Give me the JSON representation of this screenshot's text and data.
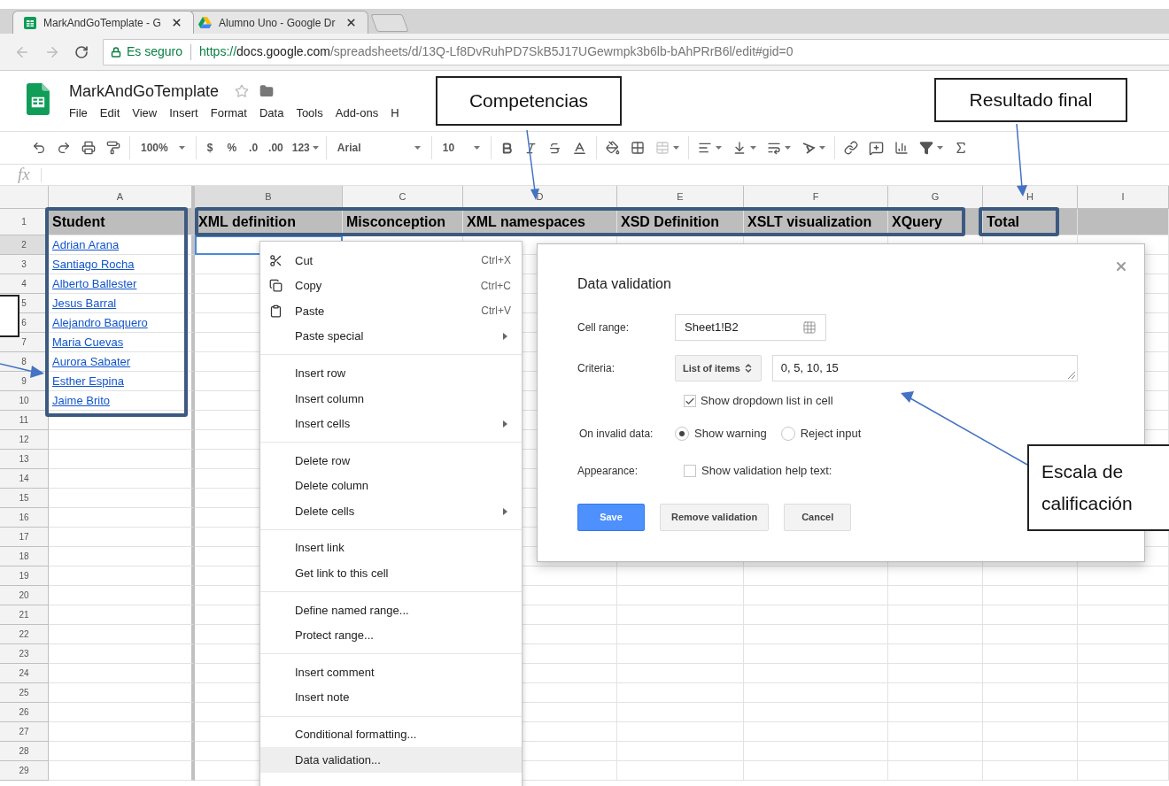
{
  "browser": {
    "tabs": [
      {
        "title": "MarkAndGoTemplate - G",
        "selected": true
      },
      {
        "title": "Alumno Uno - Google Dr",
        "selected": false
      }
    ],
    "address": {
      "secure_label": "Es seguro",
      "scheme": "https://",
      "host": "docs.google.com",
      "path": "/spreadsheets/d/13Q-Lf8DvRuhPD7SkB5J17UGewmpk3b6lb-bAhPRrB6l/edit#gid=0"
    }
  },
  "document": {
    "title": "MarkAndGoTemplate",
    "menus": [
      "File",
      "Edit",
      "View",
      "Insert",
      "Format",
      "Data",
      "Tools",
      "Add-ons",
      "H"
    ]
  },
  "toolbar": {
    "zoom": "100%",
    "currency": "$",
    "percent": "%",
    "decimal_decrease": ".0",
    "decimal_increase": ".00",
    "more_formats": "123",
    "font": "Arial",
    "font_size": "10"
  },
  "formula_bar": {
    "label": "fx"
  },
  "sheet": {
    "columns": [
      {
        "label": "A",
        "selected": false
      },
      {
        "label": "B",
        "selected": true
      },
      {
        "label": "C",
        "selected": false
      },
      {
        "label": "D",
        "selected": false
      },
      {
        "label": "E",
        "selected": false
      },
      {
        "label": "F",
        "selected": false
      },
      {
        "label": "G",
        "selected": false
      },
      {
        "label": "H",
        "selected": false
      },
      {
        "label": "I",
        "selected": false
      }
    ],
    "rows": [
      {
        "label": "1",
        "selected": false
      },
      {
        "label": "2",
        "selected": true
      },
      {
        "label": "3",
        "selected": false
      },
      {
        "label": "4",
        "selected": false
      },
      {
        "label": "5",
        "selected": false
      },
      {
        "label": "6",
        "selected": false
      },
      {
        "label": "7",
        "selected": false
      },
      {
        "label": "8",
        "selected": false
      },
      {
        "label": "9",
        "selected": false
      },
      {
        "label": "10",
        "selected": false
      },
      {
        "label": "11",
        "selected": false
      },
      {
        "label": "12",
        "selected": false
      },
      {
        "label": "13",
        "selected": false
      },
      {
        "label": "14",
        "selected": false
      },
      {
        "label": "15",
        "selected": false
      },
      {
        "label": "16",
        "selected": false
      },
      {
        "label": "17",
        "selected": false
      },
      {
        "label": "18",
        "selected": false
      },
      {
        "label": "19",
        "selected": false
      },
      {
        "label": "20",
        "selected": false
      },
      {
        "label": "21",
        "selected": false
      },
      {
        "label": "22",
        "selected": false
      },
      {
        "label": "23",
        "selected": false
      },
      {
        "label": "24",
        "selected": false
      },
      {
        "label": "25",
        "selected": false
      },
      {
        "label": "26",
        "selected": false
      },
      {
        "label": "27",
        "selected": false
      },
      {
        "label": "28",
        "selected": false
      },
      {
        "label": "29",
        "selected": false
      }
    ],
    "header_row": [
      "Student",
      "XML definition",
      "Misconception",
      "XML namespaces",
      "XSD Definition",
      "XSLT visualization",
      "XQuery",
      "Total"
    ],
    "students": [
      "Adrian Arana",
      "Santiago Rocha",
      "Alberto Ballester",
      "Jesus Barral",
      "Alejandro Baquero",
      "Maria Cuevas",
      "Aurora Sabater",
      "Esther Espina",
      "Jaime Brito"
    ]
  },
  "context_menu": {
    "groups": [
      [
        {
          "label": "Cut",
          "shortcut": "Ctrl+X",
          "kind": "icon",
          "submenu": false,
          "selected": false
        },
        {
          "label": "Copy",
          "shortcut": "Ctrl+C",
          "kind": "icon",
          "submenu": false,
          "selected": false
        },
        {
          "label": "Paste",
          "shortcut": "Ctrl+V",
          "kind": "icon",
          "submenu": false,
          "selected": false
        },
        {
          "label": "Paste special",
          "kind": "plain",
          "submenu": true,
          "selected": false
        }
      ],
      [
        {
          "label": "Insert row",
          "kind": "plain",
          "submenu": false,
          "selected": false
        },
        {
          "label": "Insert column",
          "kind": "plain",
          "submenu": false,
          "selected": false
        },
        {
          "label": "Insert cells",
          "kind": "plain",
          "submenu": true,
          "selected": false
        }
      ],
      [
        {
          "label": "Delete row",
          "kind": "plain",
          "submenu": false,
          "selected": false
        },
        {
          "label": "Delete column",
          "kind": "plain",
          "submenu": false,
          "selected": false
        },
        {
          "label": "Delete cells",
          "kind": "plain",
          "submenu": true,
          "selected": false
        }
      ],
      [
        {
          "label": "Insert link",
          "kind": "plain",
          "submenu": false,
          "selected": false
        },
        {
          "label": "Get link to this cell",
          "kind": "plain",
          "submenu": false,
          "selected": false
        }
      ],
      [
        {
          "label": "Define named range...",
          "kind": "plain",
          "submenu": false,
          "selected": false
        },
        {
          "label": "Protect range...",
          "kind": "plain",
          "submenu": false,
          "selected": false
        }
      ],
      [
        {
          "label": "Insert comment",
          "kind": "plain",
          "submenu": false,
          "selected": false
        },
        {
          "label": "Insert note",
          "kind": "plain",
          "submenu": false,
          "selected": false
        }
      ],
      [
        {
          "label": "Conditional formatting...",
          "kind": "plain",
          "submenu": false,
          "selected": false
        },
        {
          "label": "Data validation...",
          "kind": "plain",
          "submenu": false,
          "selected": true
        }
      ]
    ]
  },
  "dialog": {
    "title": "Data validation",
    "cell_range": {
      "label": "Cell range:",
      "value": "Sheet1!B2"
    },
    "criteria": {
      "label": "Criteria:",
      "type": "List of items",
      "value": "0, 5, 10, 15"
    },
    "show_dropdown": {
      "label": "Show dropdown list in cell",
      "checked": true
    },
    "invalid_data": {
      "label": "On invalid data:",
      "options": [
        {
          "label": "Show warning",
          "selected": true
        },
        {
          "label": "Reject input",
          "selected": false
        }
      ]
    },
    "appearance": {
      "label": "Appearance:",
      "checkbox_label": "Show validation help text:",
      "checked": false
    },
    "buttons": [
      "Save",
      "Remove validation",
      "Cancel"
    ]
  },
  "callouts": [
    "Competencias",
    "Resultado final",
    "Escala de calificación"
  ]
}
